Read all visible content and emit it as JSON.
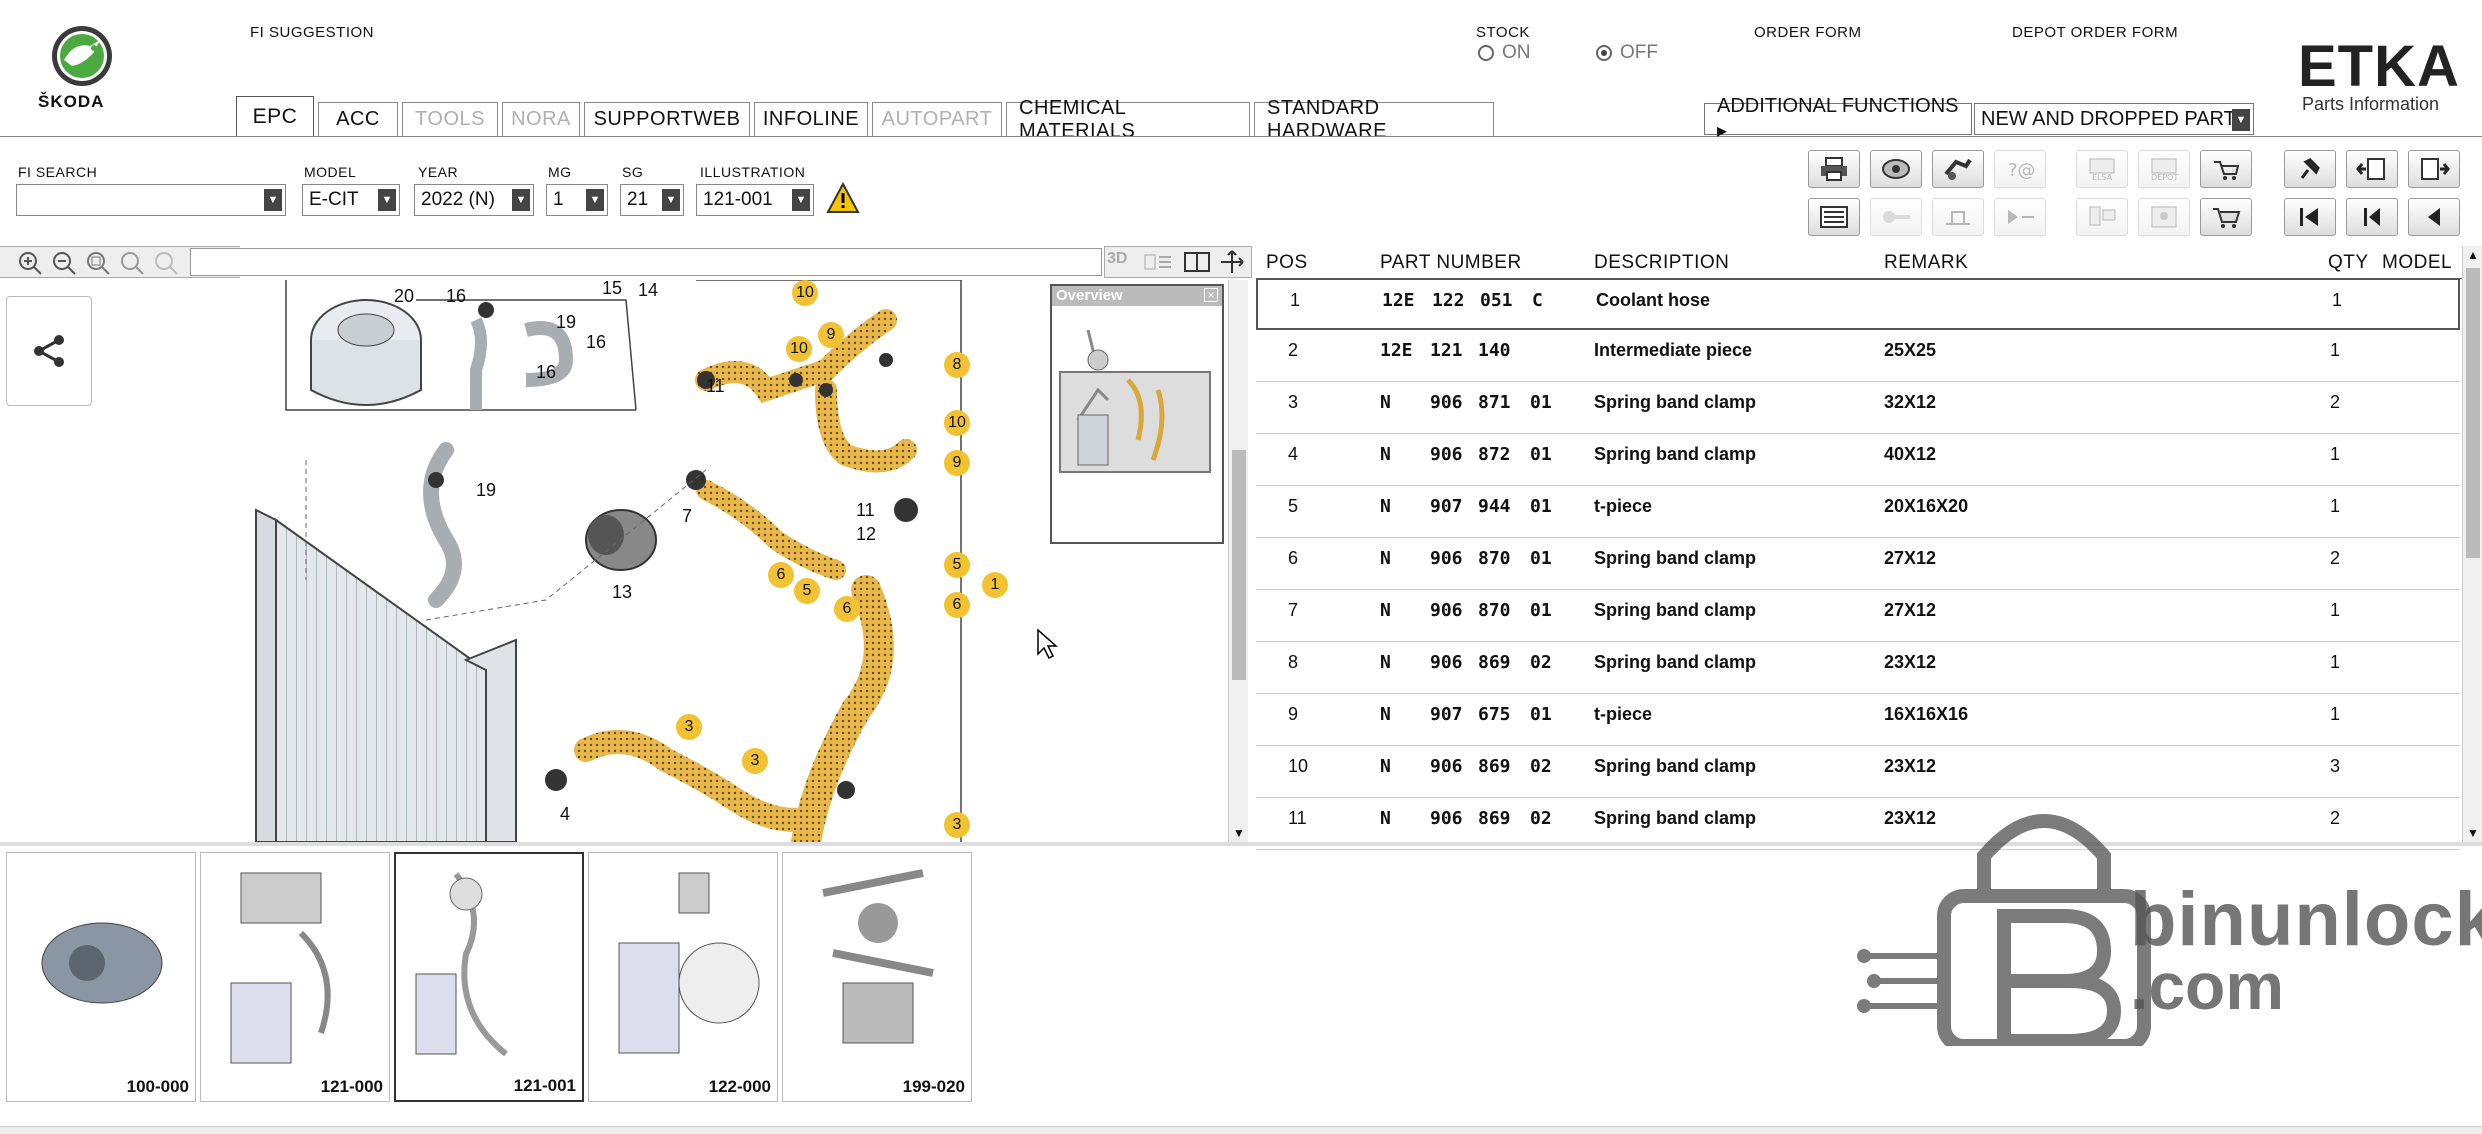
{
  "brand": {
    "name": "ŠKODA"
  },
  "header": {
    "fi_suggestion": "FI SUGGESTION",
    "stock_label": "STOCK",
    "stock_on": "ON",
    "stock_off": "OFF",
    "stock_selected": "OFF",
    "order_form": "ORDER FORM",
    "depot_order_form": "DEPOT ORDER FORM",
    "etka_title": "ETKA",
    "etka_subtitle": "Parts Information"
  },
  "tabs": [
    {
      "label": "EPC",
      "state": "active"
    },
    {
      "label": "ACC",
      "state": "normal"
    },
    {
      "label": "TOOLS",
      "state": "disabled"
    },
    {
      "label": "NORA",
      "state": "disabled"
    },
    {
      "label": "SUPPORTWEB",
      "state": "normal"
    },
    {
      "label": "INFOLINE",
      "state": "normal"
    },
    {
      "label": "AUTOPART",
      "state": "disabled"
    },
    {
      "label": "CHEMICAL MATERIALS",
      "state": "normal"
    },
    {
      "label": "STANDARD HARDWARE",
      "state": "normal"
    }
  ],
  "additional_functions": "ADDITIONAL FUNCTIONS ▸",
  "new_dropped": "NEW AND DROPPED PART",
  "filters": {
    "fi_search": {
      "label": "FI SEARCH",
      "value": ""
    },
    "model": {
      "label": "MODEL",
      "value": "E-CIT"
    },
    "year": {
      "label": "YEAR",
      "value": "2022 (N)"
    },
    "mg": {
      "label": "MG",
      "value": "1"
    },
    "sg": {
      "label": "SG",
      "value": "21"
    },
    "illustration": {
      "label": "ILLUSTRATION",
      "value": "121-001"
    }
  },
  "overview": {
    "title": "Overview"
  },
  "table": {
    "headers": {
      "pos": "POS",
      "part_number": "PART NUMBER",
      "description": "DESCRIPTION",
      "remark": "REMARK",
      "qty": "QTY",
      "model": "MODEL"
    },
    "rows": [
      {
        "pos": "1",
        "p1": "12E",
        "p2": "122",
        "p3": "051",
        "p4": "C",
        "desc": "Coolant hose",
        "remark": "",
        "qty": "1"
      },
      {
        "pos": "2",
        "p1": "12E",
        "p2": "121",
        "p3": "140",
        "p4": "",
        "desc": "Intermediate piece",
        "remark": "25X25",
        "qty": "1"
      },
      {
        "pos": "3",
        "p1": "N",
        "p2": "906",
        "p3": "871",
        "p4": "01",
        "desc": "Spring band clamp",
        "remark": "32X12",
        "qty": "2"
      },
      {
        "pos": "4",
        "p1": "N",
        "p2": "906",
        "p3": "872",
        "p4": "01",
        "desc": "Spring band clamp",
        "remark": "40X12",
        "qty": "1"
      },
      {
        "pos": "5",
        "p1": "N",
        "p2": "907",
        "p3": "944",
        "p4": "01",
        "desc": "t-piece",
        "remark": "20X16X20",
        "qty": "1"
      },
      {
        "pos": "6",
        "p1": "N",
        "p2": "906",
        "p3": "870",
        "p4": "01",
        "desc": "Spring band clamp",
        "remark": "27X12",
        "qty": "2"
      },
      {
        "pos": "7",
        "p1": "N",
        "p2": "906",
        "p3": "870",
        "p4": "01",
        "desc": "Spring band clamp",
        "remark": "27X12",
        "qty": "1"
      },
      {
        "pos": "8",
        "p1": "N",
        "p2": "906",
        "p3": "869",
        "p4": "02",
        "desc": "Spring band clamp",
        "remark": "23X12",
        "qty": "1"
      },
      {
        "pos": "9",
        "p1": "N",
        "p2": "907",
        "p3": "675",
        "p4": "01",
        "desc": "t-piece",
        "remark": "16X16X16",
        "qty": "1"
      },
      {
        "pos": "10",
        "p1": "N",
        "p2": "906",
        "p3": "869",
        "p4": "02",
        "desc": "Spring band clamp",
        "remark": "23X12",
        "qty": "3"
      },
      {
        "pos": "11",
        "p1": "N",
        "p2": "906",
        "p3": "869",
        "p4": "02",
        "desc": "Spring band clamp",
        "remark": "23X12",
        "qty": "2"
      }
    ]
  },
  "thumbnails": [
    {
      "label": "100-000"
    },
    {
      "label": "121-000"
    },
    {
      "label": "121-001",
      "selected": true
    },
    {
      "label": "122-000"
    },
    {
      "label": "199-020"
    }
  ],
  "callouts": [
    "20",
    "16",
    "15",
    "14",
    "19",
    "16",
    "16",
    "19",
    "13",
    "7",
    "11",
    "10",
    "9",
    "10",
    "8",
    "10",
    "9",
    "11",
    "12",
    "5",
    "1",
    "6",
    "6",
    "5",
    "6",
    "3",
    "3",
    "4",
    "3"
  ],
  "watermark": {
    "text1": "binunlock",
    "text2": ".com"
  }
}
